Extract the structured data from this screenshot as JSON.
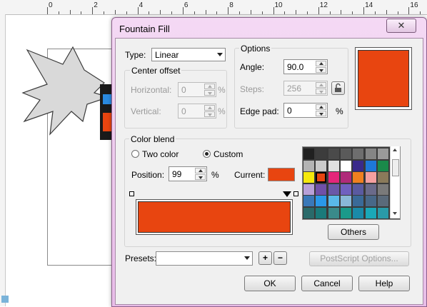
{
  "ruler": {
    "labels": [
      "0",
      "2",
      "4",
      "6",
      "8",
      "10",
      "12",
      "14",
      "16"
    ]
  },
  "dialog": {
    "title": "Fountain Fill",
    "close_glyph": "✕",
    "type": {
      "label": "Type:",
      "value": "Linear"
    },
    "center_offset": {
      "title": "Center offset",
      "horizontal": {
        "label": "Horizontal:",
        "value": "0",
        "unit": "%"
      },
      "vertical": {
        "label": "Vertical:",
        "value": "0",
        "unit": "%"
      }
    },
    "options": {
      "title": "Options",
      "angle": {
        "label": "Angle:",
        "value": "90.0"
      },
      "steps": {
        "label": "Steps:",
        "value": "256"
      },
      "edge_pad": {
        "label": "Edge pad:",
        "value": "0",
        "unit": "%"
      }
    },
    "preview_color": "#e84510",
    "color_blend": {
      "title": "Color blend",
      "two_color": "Two color",
      "custom": "Custom",
      "selected_mode": "custom",
      "position": {
        "label": "Position:",
        "value": "99",
        "unit": "%"
      },
      "current_label": "Current:",
      "current_color": "#e84510",
      "gradient_color": "#e84510"
    },
    "palette_colors": [
      "#202020",
      "#3c3c3c",
      "#4a4a4a",
      "#5a5a5a",
      "#6e6e6e",
      "#858585",
      "#9a9a9a",
      "#b4b4b4",
      "#cacaca",
      "#e0e0e0",
      "#ffffff",
      "#3a2a8a",
      "#1e78d8",
      "#1a8a4a",
      "#f5e80c",
      "#e84510",
      "#e4267a",
      "#b02a7a",
      "#f08020",
      "#f4a0a0",
      "#8a7a5a",
      "#b8a0d8",
      "#7050a8",
      "#6a58a8",
      "#7060c0",
      "#5a5aa0",
      "#6a6a8a",
      "#7a7a7a",
      "#3a78b8",
      "#2a98e8",
      "#5ab8e8",
      "#8ab8d8",
      "#3a6a98",
      "#486888",
      "#5a6a7a",
      "#2a6a6a",
      "#1a7a7a",
      "#3a8a8a",
      "#1a9a8a",
      "#1a8aa8",
      "#1aa8b8",
      "#2a9aa8"
    ],
    "others_label": "Others",
    "presets": {
      "label": "Presets:",
      "value": ""
    },
    "postscript_label": "PostScript Options...",
    "ok_label": "OK",
    "cancel_label": "Cancel",
    "help_label": "Help"
  }
}
